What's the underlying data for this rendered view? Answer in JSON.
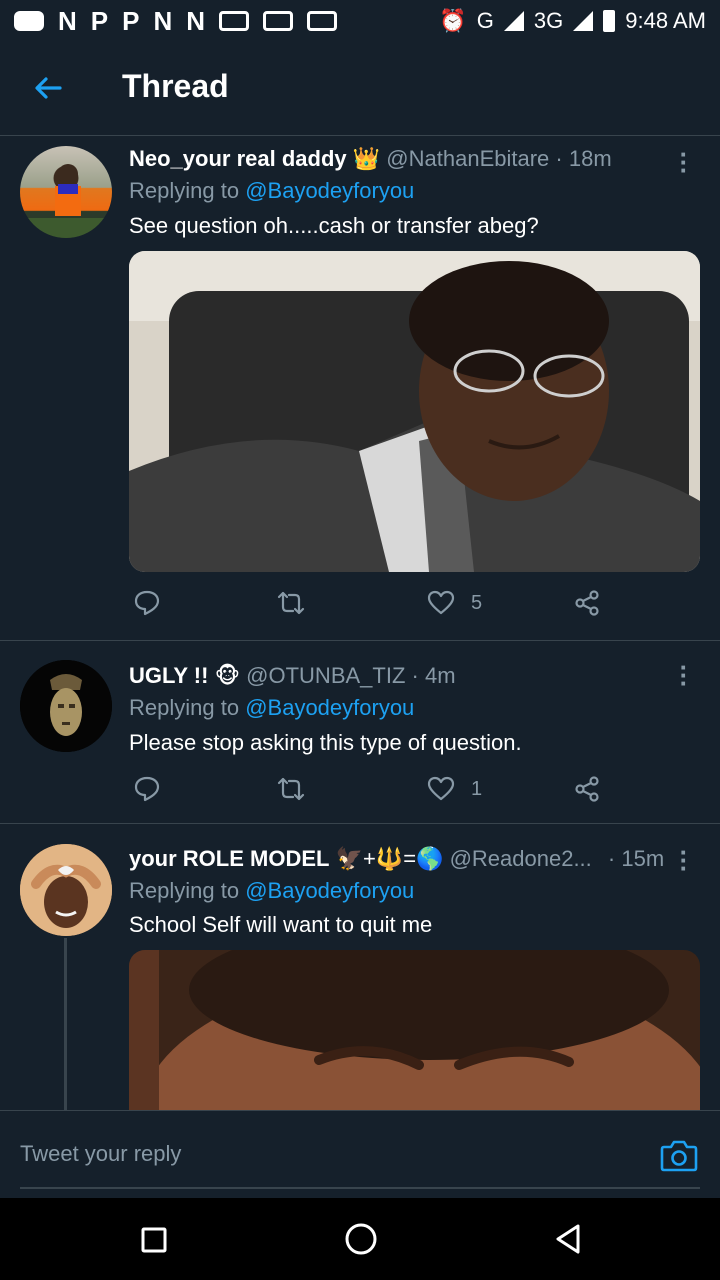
{
  "status_bar": {
    "left_icons": [
      "N",
      "P",
      "P",
      "N",
      "N"
    ],
    "network": "G",
    "network2": "3G",
    "time": "9:48 AM"
  },
  "header": {
    "title": "Thread"
  },
  "tweets": [
    {
      "name": "Neo_your real daddy",
      "name_emoji": "👑",
      "handle": "@NathanEbitare",
      "time": "· 18m",
      "replying_prefix": "Replying to",
      "replying_to": "@Bayodeyforyou",
      "text": "See question oh.....cash or transfer abeg?",
      "likes": "5"
    },
    {
      "name": "UGLY !!",
      "name_emoji": "🐵",
      "handle": "@OTUNBA_TIZ",
      "time": "· 4m",
      "replying_prefix": "Replying to",
      "replying_to": "@Bayodeyforyou",
      "text": "Please stop asking this type of question.",
      "likes": "1"
    },
    {
      "name": "your ROLE MODEL",
      "name_emoji": "🦅+🔱=🌎",
      "handle": "@Readone2...",
      "time": "· 15m",
      "replying_prefix": "Replying to",
      "replying_to": "@Bayodeyforyou",
      "text": "School Self  will want to quit me"
    }
  ],
  "reply_box": {
    "placeholder": "Tweet your reply"
  },
  "colors": {
    "background": "#15202b",
    "accent": "#1da1f2",
    "muted": "#8899a6",
    "divider": "#38444d"
  }
}
